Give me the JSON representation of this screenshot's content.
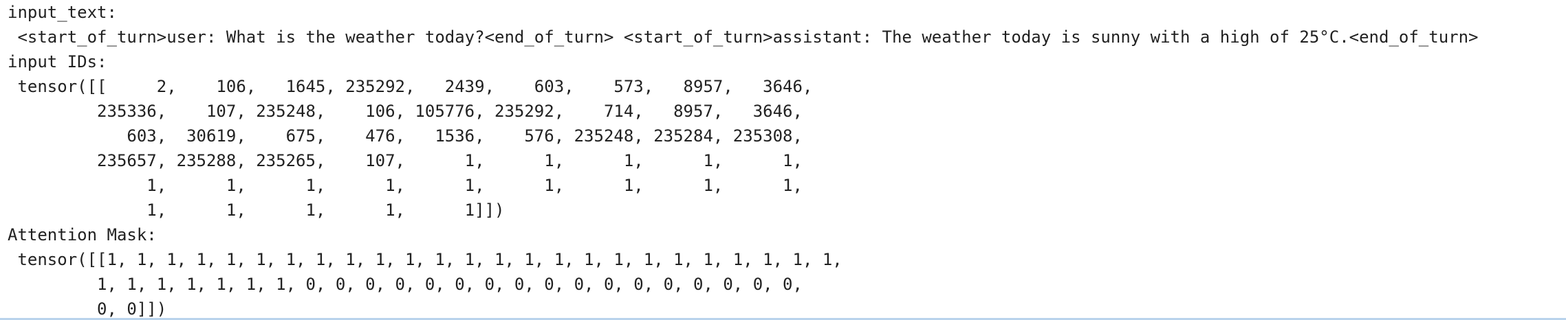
{
  "output": {
    "lines": [
      "input_text:",
      " <start_of_turn>user: What is the weather today?<end_of_turn> <start_of_turn>assistant: The weather today is sunny with a high of 25°C.<end_of_turn>",
      "input IDs:",
      " tensor([[     2,    106,   1645, 235292,   2439,    603,    573,   8957,   3646,",
      "         235336,    107, 235248,    106, 105776, 235292,    714,   8957,   3646,",
      "            603,  30619,    675,    476,   1536,    576, 235248, 235284, 235308,",
      "         235657, 235288, 235265,    107,      1,      1,      1,      1,      1,",
      "              1,      1,      1,      1,      1,      1,      1,      1,      1,",
      "              1,      1,      1,      1,      1]])",
      "Attention Mask:",
      " tensor([[1, 1, 1, 1, 1, 1, 1, 1, 1, 1, 1, 1, 1, 1, 1, 1, 1, 1, 1, 1, 1, 1, 1, 1, 1,",
      "         1, 1, 1, 1, 1, 1, 1, 0, 0, 0, 0, 0, 0, 0, 0, 0, 0, 0, 0, 0, 0, 0, 0, 0,",
      "         0, 0]])"
    ]
  }
}
